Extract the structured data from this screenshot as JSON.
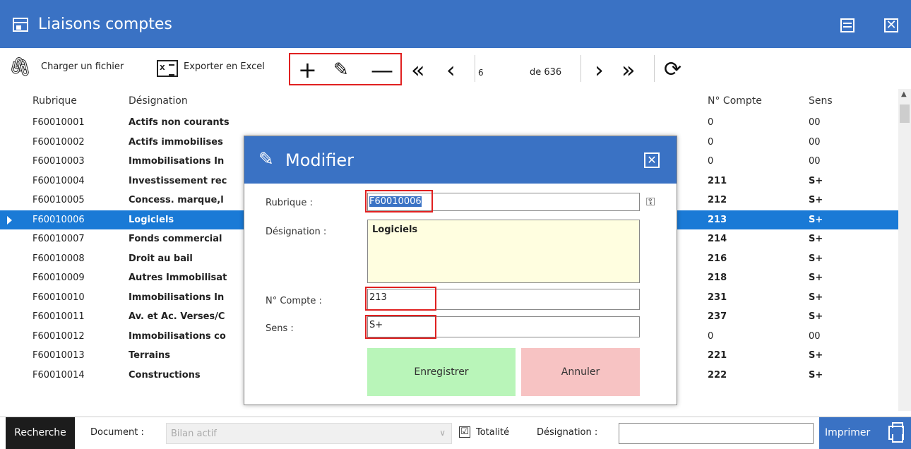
{
  "window": {
    "title": "Liaisons comptes"
  },
  "toolbar": {
    "load_file": "Charger un fichier",
    "export_excel": "Exporter en Excel",
    "excel_icon_text": "X",
    "page_current": "6",
    "page_total": "de 636"
  },
  "grid": {
    "columns": {
      "rubrique": "Rubrique",
      "designation": "Désignation",
      "compte": "N° Compte",
      "sens": "Sens"
    },
    "rows": [
      {
        "rubrique": "F60010001",
        "designation": "Actifs non courants",
        "compte": "0",
        "sens": "00"
      },
      {
        "rubrique": "F60010002",
        "designation": "Actifs immobilises",
        "compte": "0",
        "sens": "00"
      },
      {
        "rubrique": "F60010003",
        "designation": "Immobilisations In",
        "compte": "0",
        "sens": "00"
      },
      {
        "rubrique": "F60010004",
        "designation": "Investissement rec",
        "compte": "211",
        "sens": "S+"
      },
      {
        "rubrique": "F60010005",
        "designation": "Concess. marque,l",
        "compte": "212",
        "sens": "S+"
      },
      {
        "rubrique": "F60010006",
        "designation": "Logiciels",
        "compte": "213",
        "sens": "S+"
      },
      {
        "rubrique": "F60010007",
        "designation": "Fonds commercial",
        "compte": "214",
        "sens": "S+"
      },
      {
        "rubrique": "F60010008",
        "designation": "Droit au bail",
        "compte": "216",
        "sens": "S+"
      },
      {
        "rubrique": "F60010009",
        "designation": "Autres Immobilisat",
        "compte": "218",
        "sens": "S+"
      },
      {
        "rubrique": "F60010010",
        "designation": "Immobilisations In",
        "compte": "231",
        "sens": "S+"
      },
      {
        "rubrique": "F60010011",
        "designation": "Av. et Ac. Verses/C",
        "compte": "237",
        "sens": "S+"
      },
      {
        "rubrique": "F60010012",
        "designation": "Immobilisations co",
        "compte": "0",
        "sens": "00"
      },
      {
        "rubrique": "F60010013",
        "designation": "Terrains",
        "compte": "221",
        "sens": "S+"
      },
      {
        "rubrique": "F60010014",
        "designation": "Constructions",
        "compte": "222",
        "sens": "S+"
      }
    ]
  },
  "statusbar": {
    "search_label": "Recherche",
    "document_label": "Document :",
    "document_value": "Bilan actif",
    "totalite_label": "Totalité",
    "totalite_checked": "☑",
    "designation_label": "Désignation :",
    "designation_value": "",
    "print_label": "Imprimer"
  },
  "dialog": {
    "title": "Modifier",
    "rubrique_label": "Rubrique :",
    "rubrique_value": "F60010006",
    "designation_label": "Désignation :",
    "designation_value": "Logiciels",
    "compte_label": "N° Compte :",
    "compte_value": "213",
    "sens_label": "Sens :",
    "sens_value": "S+",
    "save_label": "Enregistrer",
    "cancel_label": "Annuler"
  },
  "colors": {
    "accent": "#3a72c4",
    "selected_row": "#1a7ad6",
    "highlight_box": "#e02020",
    "save_bg": "#b9f5b9",
    "cancel_bg": "#f7c3c3"
  }
}
